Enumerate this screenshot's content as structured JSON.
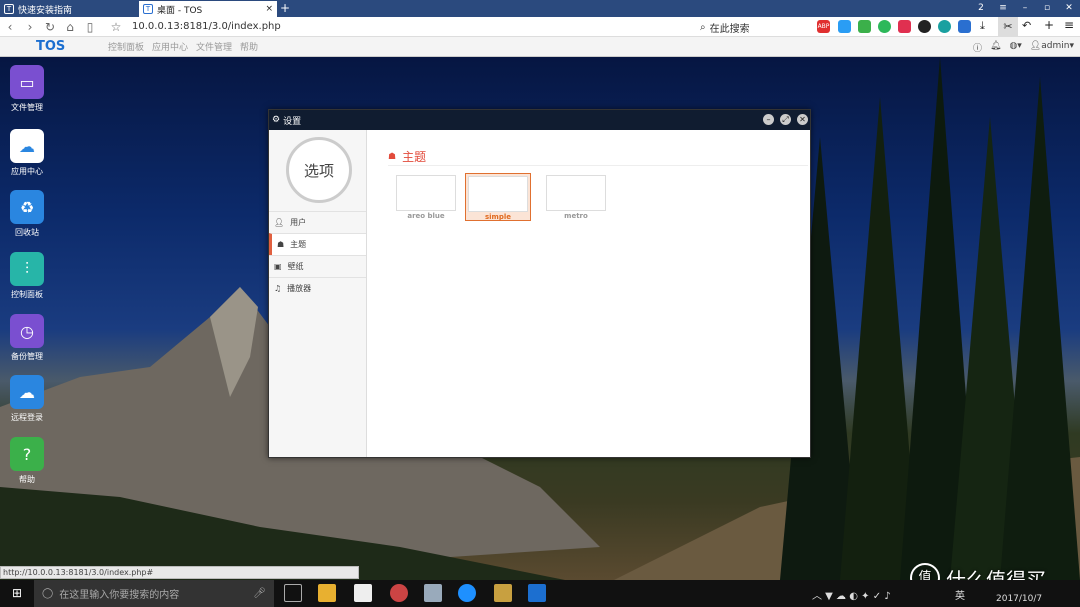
{
  "browser": {
    "tabs": [
      {
        "label": "快速安装指南",
        "active": false
      },
      {
        "label": "桌面 - TOS",
        "active": true
      }
    ],
    "tab_badge": "2",
    "url": "10.0.0.13:8181/3.0/index.php",
    "search_placeholder": "在此搜索",
    "ext_abp": "ABP",
    "bookmarks": {
      "logo": "TOS",
      "items": [
        "控制面板",
        "应用中心",
        "文件管理",
        "帮助"
      ],
      "user": "admin"
    }
  },
  "desktop": {
    "icons": [
      {
        "label": "文件管理",
        "icon": "monitor-icon",
        "color": "#7a4fd0"
      },
      {
        "label": "应用中心",
        "icon": "cloud-bag-icon",
        "color": "#2a86e0"
      },
      {
        "label": "回收站",
        "icon": "trash-icon",
        "color": "#2a86e0"
      },
      {
        "label": "控制面板",
        "icon": "sliders-icon",
        "color": "#27b5a8"
      },
      {
        "label": "备份管理",
        "icon": "history-clock-icon",
        "color": "#7a4fd0"
      },
      {
        "label": "远程登录",
        "icon": "cloud-icon",
        "color": "#2a86e0"
      },
      {
        "label": "帮助",
        "icon": "question-icon",
        "color": "#3bb04a"
      }
    ]
  },
  "window": {
    "title": "设置",
    "circle_label": "选项",
    "menu": [
      {
        "label": "用户",
        "icon": "user-icon",
        "active": false
      },
      {
        "label": "主题",
        "icon": "palette-icon",
        "active": true
      },
      {
        "label": "壁纸",
        "icon": "image-icon",
        "active": false
      },
      {
        "label": "播放器",
        "icon": "music-icon",
        "active": false
      }
    ],
    "section_title": "主题",
    "themes": [
      {
        "name": "areo blue",
        "selected": false
      },
      {
        "name": "simple",
        "selected": true
      },
      {
        "name": "metro",
        "selected": false
      }
    ]
  },
  "status_url": "http://10.0.0.13:8181/3.0/index.php#",
  "taskbar": {
    "search_placeholder": "在这里输入你要搜索的内容",
    "ime": "英",
    "date": "2017/10/7"
  },
  "watermark": "什么值得买",
  "colors": {
    "accent": "#e24b3b",
    "browser_tab": "#2b4a7e",
    "tos_blue": "#1c6fd0"
  }
}
